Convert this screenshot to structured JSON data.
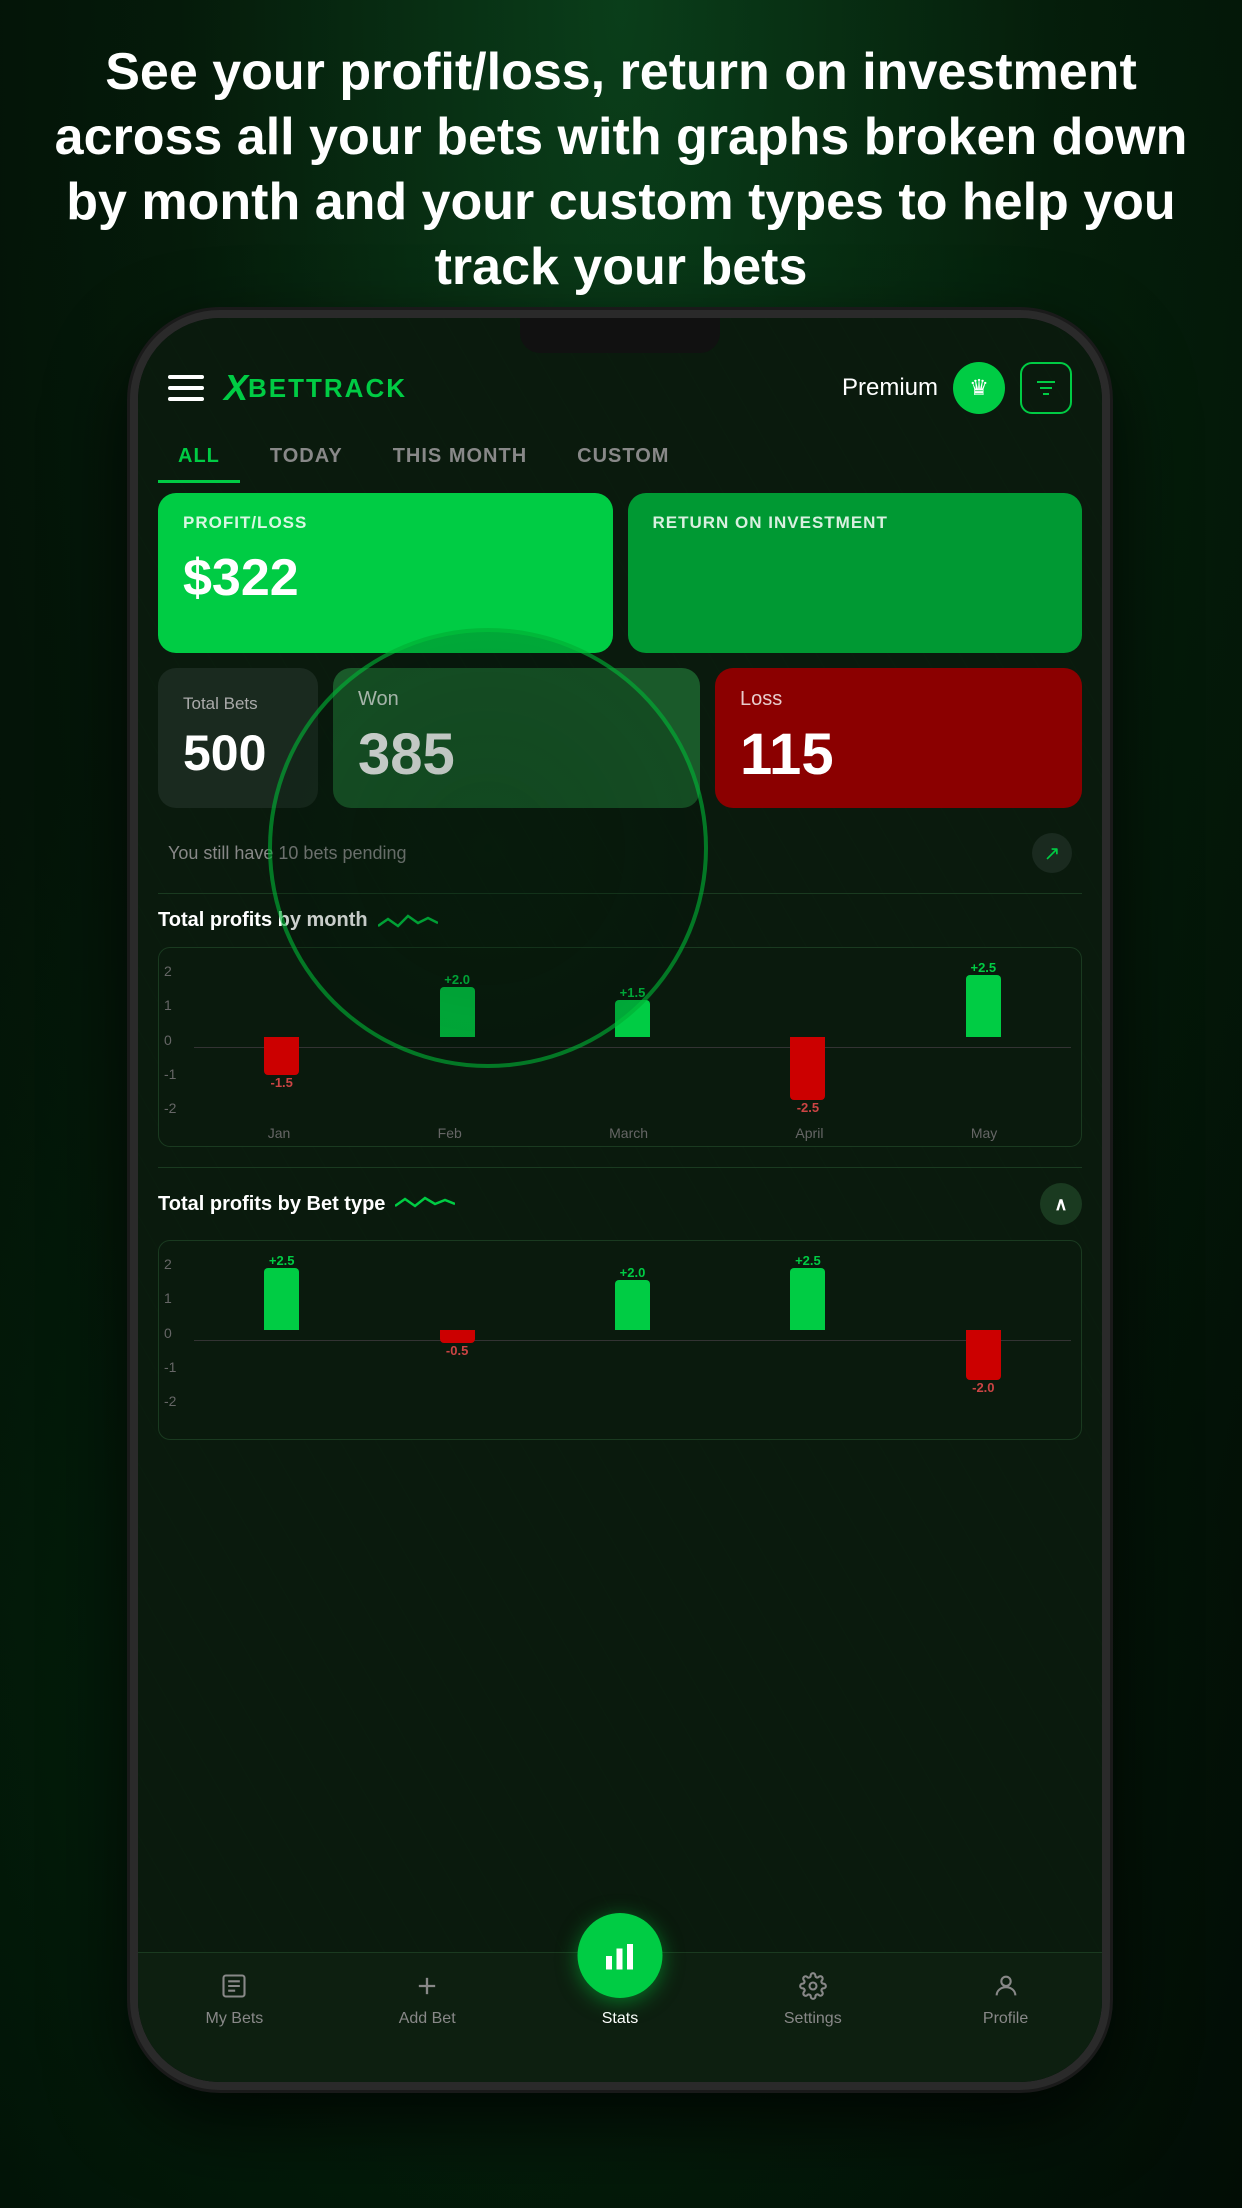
{
  "hero": {
    "text": "See your profit/loss, return on investment across all your bets with graphs broken down by month and your custom types to help you track your bets"
  },
  "header": {
    "logo_x": "X",
    "logo_text": "BETTRACK",
    "premium_label": "Premium",
    "crown_icon": "♛",
    "filter_icon": "⚙"
  },
  "tabs": [
    {
      "label": "ALL",
      "active": true
    },
    {
      "label": "TODAY",
      "active": false
    },
    {
      "label": "THIS MONTH",
      "active": false
    },
    {
      "label": "CUSTOM",
      "active": false
    }
  ],
  "cards": {
    "profit_loss_label": "PROFIT/LOSS",
    "profit_loss_value": "$322",
    "roi_label": "RETURN ON INVESTMENT",
    "total_bets_label": "Total Bets",
    "total_bets_value": "500",
    "won_label": "Won",
    "won_value": "385",
    "loss_label": "Loss",
    "loss_value": "115"
  },
  "pending": {
    "text": "You still have 10 bets pending",
    "arrow_icon": "↗"
  },
  "chart1": {
    "title": "Total profits by month",
    "months": [
      "Jan",
      "Feb",
      "March",
      "April",
      "May"
    ],
    "values": [
      -1.5,
      2.0,
      1.5,
      -2.5,
      2.5
    ],
    "y_labels": [
      "2",
      "1",
      "0",
      "-1",
      "-2"
    ]
  },
  "chart2": {
    "title": "Total profits by Bet type",
    "values": [
      2.5,
      -0.5,
      2.0,
      2.5,
      -2.0
    ],
    "y_labels": [
      "2",
      "1",
      "0",
      "-1",
      "-2"
    ]
  },
  "bottom_nav": [
    {
      "label": "My Bets",
      "icon": "📋",
      "active": false
    },
    {
      "label": "Add Bet",
      "icon": "+",
      "active": false
    },
    {
      "label": "Stats",
      "icon": "📊",
      "active": true
    },
    {
      "label": "Settings",
      "icon": "⚙",
      "active": false
    },
    {
      "label": "Profile",
      "icon": "👤",
      "active": false
    }
  ]
}
